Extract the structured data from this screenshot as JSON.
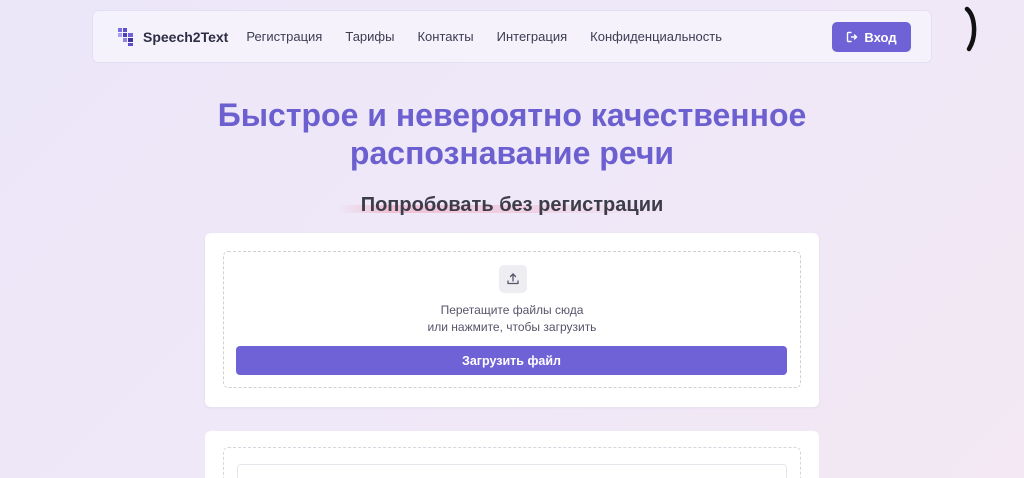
{
  "brand": {
    "name": "Speech2Text",
    "logo_icon": "grid-logo-icon"
  },
  "nav": {
    "links": [
      {
        "label": "Регистрация"
      },
      {
        "label": "Тарифы"
      },
      {
        "label": "Контакты"
      },
      {
        "label": "Интеграция"
      },
      {
        "label": "Конфиденциальность"
      }
    ],
    "login_label": "Вход",
    "login_icon": "login-icon"
  },
  "hero": {
    "title_line1": "Быстрое и невероятно качественное",
    "title_line2": "распознавание речи",
    "subtitle": "Попробовать без регистрации"
  },
  "upload": {
    "icon": "upload-icon",
    "drop_line1": "Перетащите файлы сюда",
    "drop_line2": "или нажмите, чтобы загрузить",
    "button_label": "Загрузить файл"
  },
  "colors": {
    "accent": "#6f62d6",
    "title": "#6c5fd0",
    "background_start": "#ece6f9",
    "background_end": "#f3e8f3"
  }
}
